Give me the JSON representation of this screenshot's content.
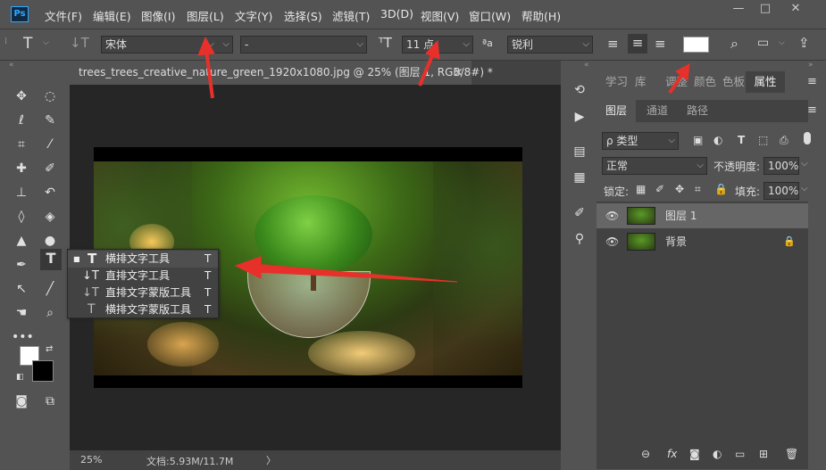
{
  "app": {
    "logo": "Ps"
  },
  "menu": [
    "文件(F)",
    "编辑(E)",
    "图像(I)",
    "图层(L)",
    "文字(Y)",
    "选择(S)",
    "滤镜(T)",
    "3D(D)",
    "视图(V)",
    "窗口(W)",
    "帮助(H)"
  ],
  "window_controls": {
    "minimize": "—",
    "maximize": "□",
    "close": "✕"
  },
  "options": {
    "tool_glyph": "T",
    "font_family": "宋体",
    "font_style": "-",
    "font_size": "11 点",
    "aa_glyph": "ªa",
    "anti_alias": "锐利",
    "text_color": "#ffffff"
  },
  "document": {
    "tab_title": "trees_trees_creative_nature_green_1920x1080.jpg @ 25% (图层 1, RGB/8#) *",
    "close_glyph": "×",
    "zoom": "25%",
    "doc_info": "文档:5.93M/11.7M",
    "status_arrow": "〉"
  },
  "flyout": [
    {
      "glyph": "T",
      "label": "横排文字工具",
      "shortcut": "T",
      "active": true
    },
    {
      "glyph": "↓T",
      "label": "直排文字工具",
      "shortcut": "T",
      "active": false
    },
    {
      "glyph": "↓T",
      "label": "直排文字蒙版工具",
      "shortcut": "T",
      "active": false
    },
    {
      "glyph": "T",
      "label": "横排文字蒙版工具",
      "shortcut": "T",
      "active": false
    }
  ],
  "panel_top_tabs": [
    "学习",
    "库",
    "调整",
    "颜色",
    "色板",
    "属性"
  ],
  "panel_tabs": [
    "图层",
    "通道",
    "路径"
  ],
  "layers": {
    "filter_label": "ρ 类型",
    "blend_mode": "正常",
    "opacity_label": "不透明度:",
    "opacity_value": "100%",
    "lock_label": "锁定:",
    "fill_label": "填充:",
    "fill_value": "100%",
    "items": [
      {
        "name": "图层 1",
        "selected": true,
        "locked": false
      },
      {
        "name": "背景",
        "selected": false,
        "locked": true
      }
    ]
  },
  "colors": {
    "accent_red": "#e8302a",
    "bg": "#535353",
    "dark": "#424242"
  }
}
